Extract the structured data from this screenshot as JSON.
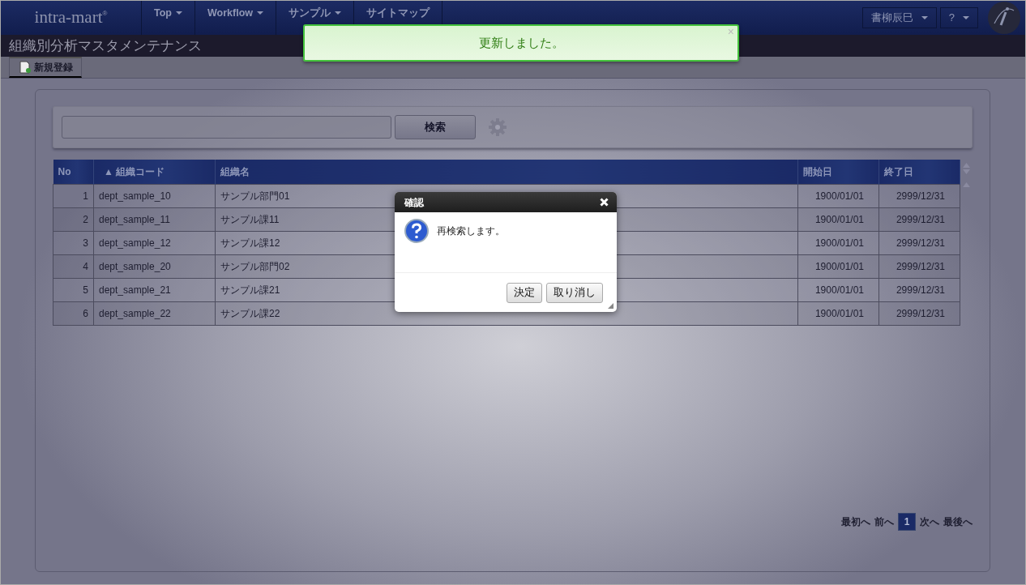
{
  "navbar": {
    "brand": "intra-mart",
    "brand_mark": "®",
    "menu": [
      {
        "label": "Top",
        "dropdown": true
      },
      {
        "label": "Workflow",
        "dropdown": true
      },
      {
        "label": "サンプル",
        "dropdown": true
      },
      {
        "label": "サイトマップ",
        "dropdown": false
      }
    ],
    "user_menu": {
      "label": "書柳辰巳",
      "dropdown": true
    },
    "help_menu": {
      "label": "?",
      "dropdown": true
    }
  },
  "page_title": "組織別分析マスタメンテナンス",
  "toolbar": {
    "buttons": [
      "新規登録"
    ]
  },
  "search": {
    "button": "検索"
  },
  "table": {
    "columns": [
      {
        "label": "No"
      },
      {
        "label": "組織コード",
        "sort_mark": "▲"
      },
      {
        "label": "組織名"
      },
      {
        "label": "開始日"
      },
      {
        "label": "終了日"
      }
    ],
    "rows": [
      [
        "1",
        "dept_sample_10",
        "サンプル部門01",
        "1900/01/01",
        "2999/12/31"
      ],
      [
        "2",
        "dept_sample_11",
        "サンプル課11",
        "1900/01/01",
        "2999/12/31"
      ],
      [
        "3",
        "dept_sample_12",
        "サンプル課12",
        "1900/01/01",
        "2999/12/31"
      ],
      [
        "4",
        "dept_sample_20",
        "サンプル部門02",
        "1900/01/01",
        "2999/12/31"
      ],
      [
        "5",
        "dept_sample_21",
        "サンプル課21",
        "1900/01/01",
        "2999/12/31"
      ],
      [
        "6",
        "dept_sample_22",
        "サンプル課22",
        "1900/01/01",
        "2999/12/31"
      ]
    ]
  },
  "pagination": {
    "first": "最初へ",
    "prev": "前へ",
    "pages": [
      {
        "label": "1",
        "selected": true
      }
    ],
    "next": "次へ",
    "last": "最後へ"
  },
  "toast": {
    "message": "更新しました。",
    "close": "×"
  },
  "dialog": {
    "title": "確認",
    "message": "再検索します。",
    "buttons": [
      "決定",
      "取り消し"
    ]
  }
}
